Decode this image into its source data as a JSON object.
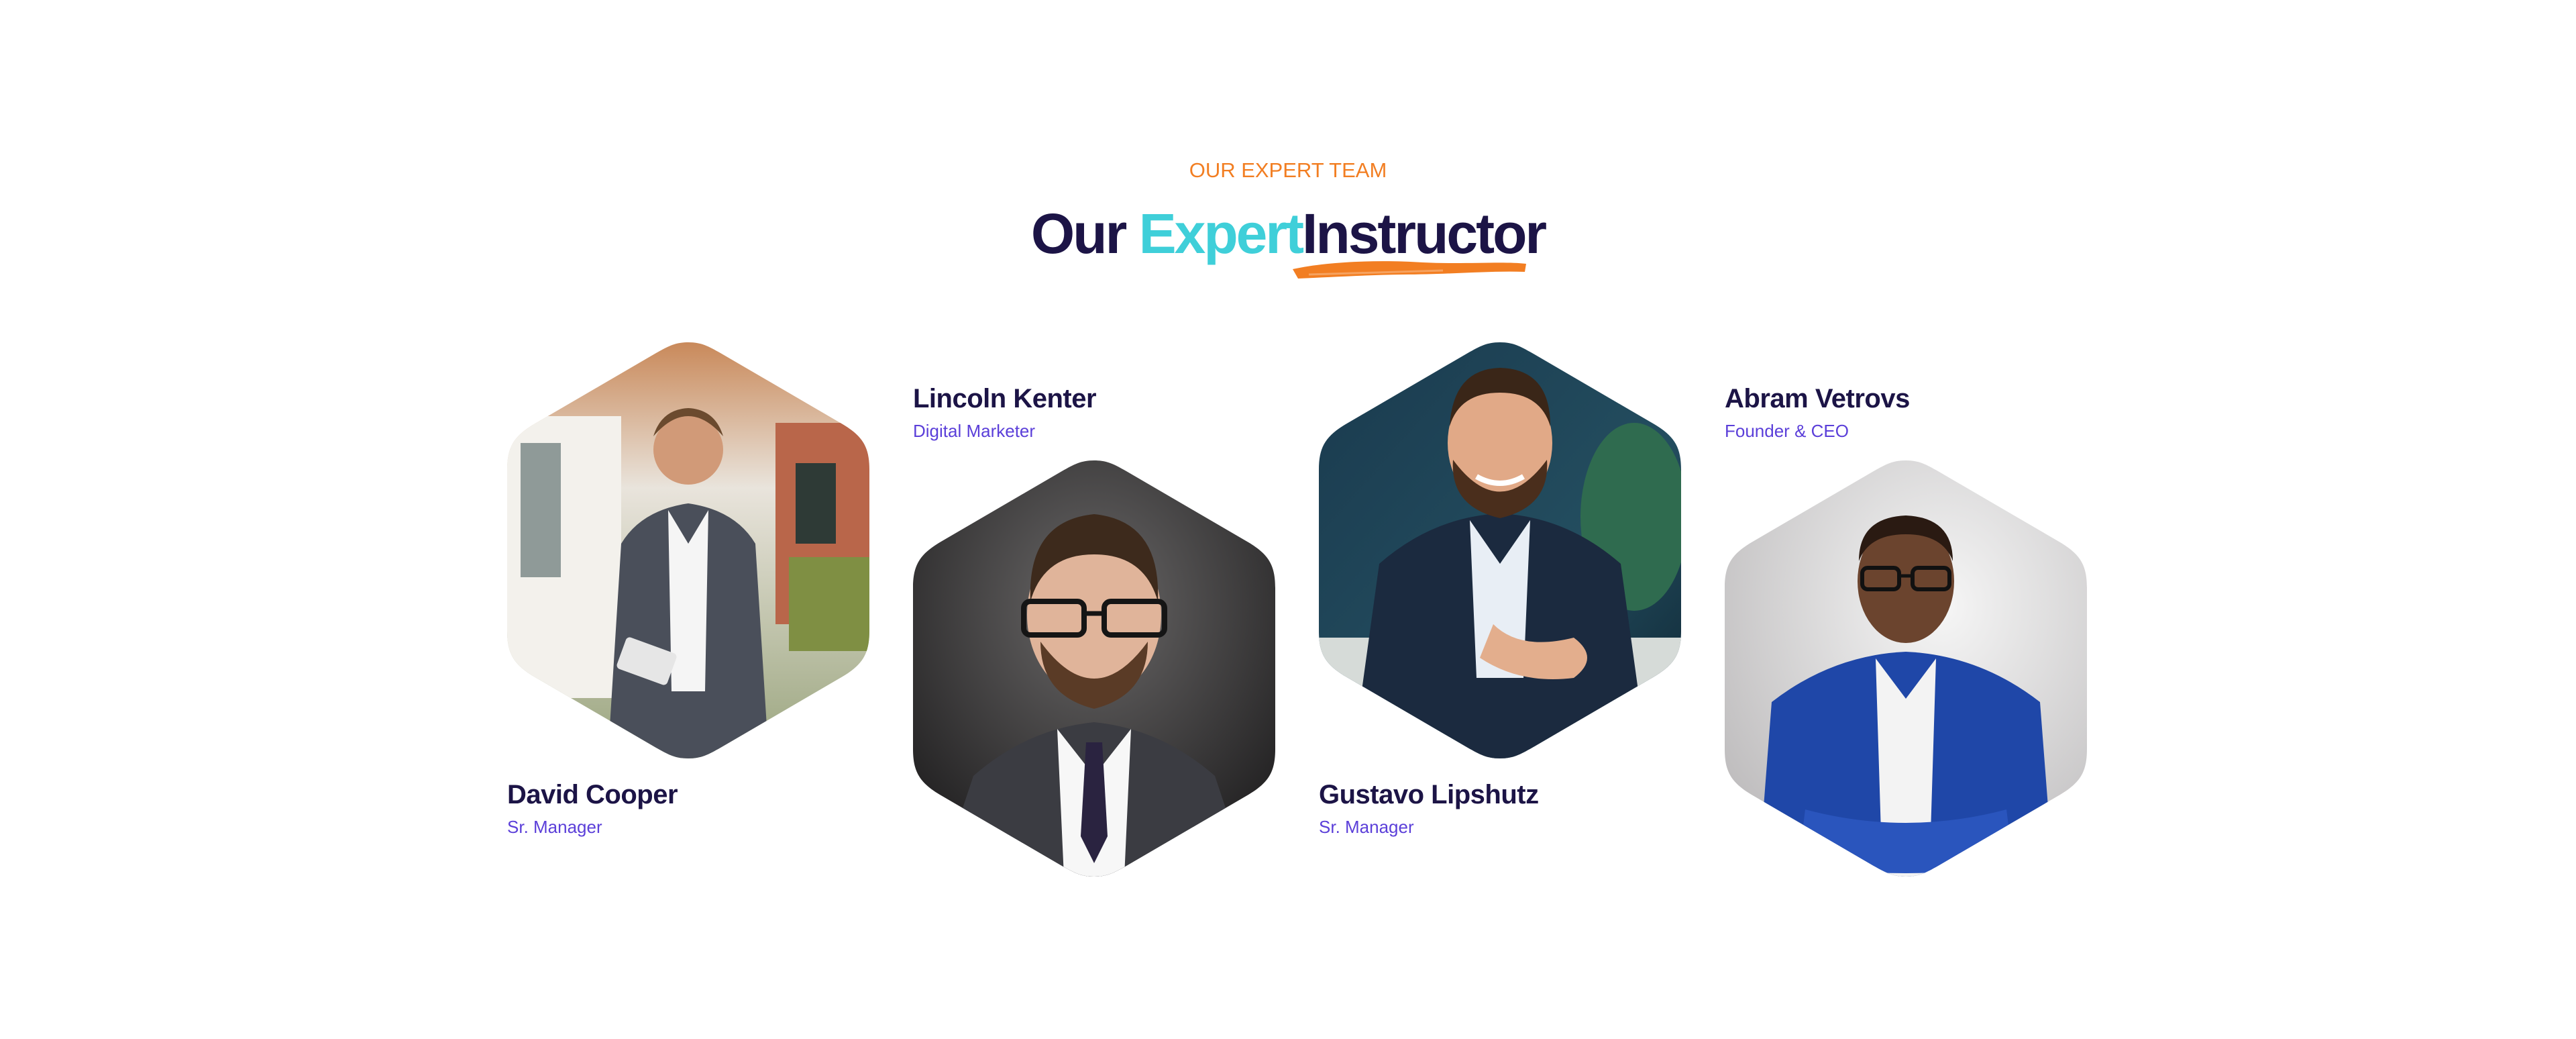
{
  "header": {
    "eyebrow": "OUR EXPERT TEAM",
    "title_part1": "Our",
    "title_part2": "Expert",
    "title_part3": "Instructor"
  },
  "colors": {
    "accent_orange": "#f27e22",
    "accent_teal": "#3fcfd9",
    "heading_navy": "#1c1446",
    "role_purple": "#5b3fd9"
  },
  "team": [
    {
      "name": "David Cooper",
      "role": "Sr. Manager"
    },
    {
      "name": "Lincoln Kenter",
      "role": "Digital Marketer"
    },
    {
      "name": "Gustavo Lipshutz",
      "role": "Sr. Manager"
    },
    {
      "name": "Abram Vetrovs",
      "role": "Founder & CEO"
    }
  ]
}
